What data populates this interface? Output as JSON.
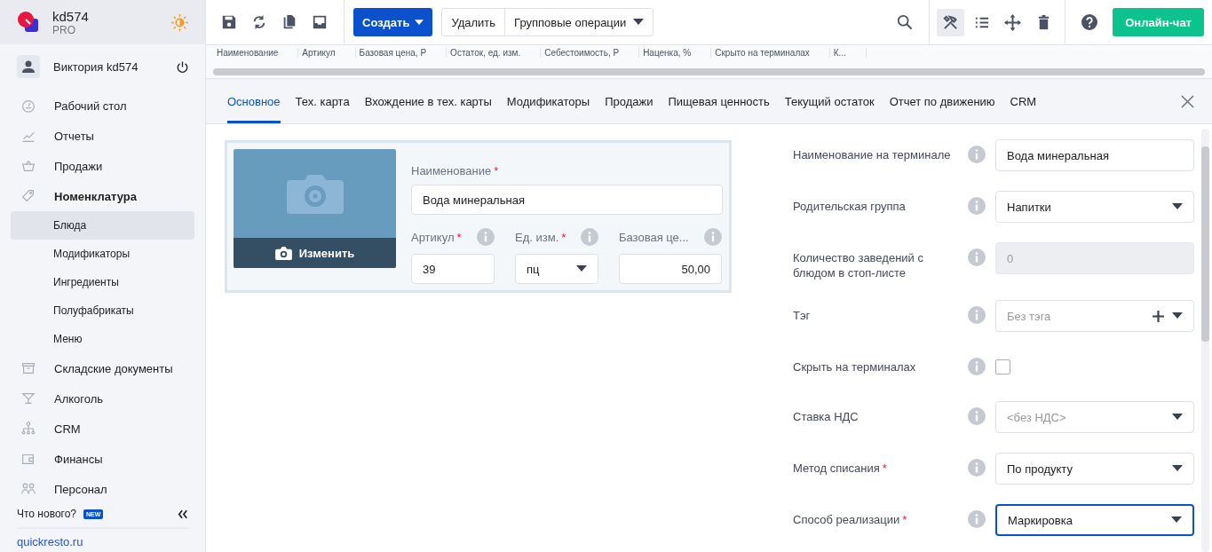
{
  "brand": {
    "name": "kd574",
    "plan": "PRO"
  },
  "user": {
    "name": "Виктория kd574"
  },
  "nav": [
    {
      "label": "Рабочий стол",
      "expanded": false
    },
    {
      "label": "Отчеты",
      "expanded": false
    },
    {
      "label": "Продажи",
      "expanded": false
    },
    {
      "label": "Номенклатура",
      "expanded": true,
      "children": [
        {
          "label": "Блюда",
          "selected": true
        },
        {
          "label": "Модификаторы",
          "selected": false
        },
        {
          "label": "Ингредиенты",
          "selected": false
        },
        {
          "label": "Полуфабрикаты",
          "selected": false
        },
        {
          "label": "Меню",
          "selected": false
        }
      ]
    },
    {
      "label": "Складские документы",
      "expanded": false
    },
    {
      "label": "Алкоголь",
      "expanded": false
    },
    {
      "label": "CRM",
      "expanded": false
    },
    {
      "label": "Финансы",
      "expanded": false
    },
    {
      "label": "Персонал",
      "expanded": false
    }
  ],
  "footer": {
    "whats_new": "Что нового?",
    "badge": "NEW",
    "link": "quickresto.ru"
  },
  "toolbar": {
    "create": "Создать",
    "delete": "Удалить",
    "group_ops": "Групповые операции",
    "chat": "Онлайн-чат",
    "view_tools": [
      {
        "selected": true
      },
      {
        "selected": false
      },
      {
        "selected": false
      },
      {
        "selected": false
      }
    ]
  },
  "table": {
    "columns": [
      "Наименование",
      "Артикул",
      "Базовая цена, Р",
      "Остаток, ед. изм.",
      "Себестоимость, Р",
      "Наценка, %",
      "Скрыто на терминалах",
      "К..."
    ]
  },
  "tabs": [
    {
      "label": "Основное",
      "selected": true
    },
    {
      "label": "Тех. карта",
      "selected": false
    },
    {
      "label": "Вхождение в тех. карты",
      "selected": false
    },
    {
      "label": "Модификаторы",
      "selected": false
    },
    {
      "label": "Продажи",
      "selected": false
    },
    {
      "label": "Пищевая ценность",
      "selected": false
    },
    {
      "label": "Текущий остаток",
      "selected": false
    },
    {
      "label": "Отчет по движению",
      "selected": false
    },
    {
      "label": "CRM",
      "selected": false
    }
  ],
  "card": {
    "change_photo": "Изменить",
    "name": {
      "label": "Наименование",
      "required_mark": "*",
      "value": "Вода минеральная"
    },
    "fields": [
      {
        "kind": "text",
        "label": "Артикул",
        "required_mark": "*",
        "value": "39"
      },
      {
        "kind": "select",
        "label": "Ед. изм.",
        "required_mark": "*",
        "value": "пц"
      },
      {
        "kind": "number",
        "label": "Базовая це...",
        "value": "50,00"
      }
    ]
  },
  "properties": [
    {
      "kind": "text",
      "label": "Наименование на терминале",
      "value": "Вода минеральная"
    },
    {
      "kind": "select",
      "label": "Родительская группа",
      "value": "Напитки"
    },
    {
      "kind": "text",
      "label": "Количество заведений с блюдом в стоп-листе",
      "placeholder": "0",
      "disabled": true
    },
    {
      "kind": "tag",
      "label": "Тэг",
      "placeholder": "Без тэга"
    },
    {
      "kind": "checkbox",
      "label": "Скрыть на терминалах",
      "checked": false
    },
    {
      "kind": "select",
      "label": "Ставка НДС",
      "placeholder": "<без НДС>"
    },
    {
      "kind": "select",
      "label": "Метод списания",
      "required_mark": "*",
      "value": "По продукту"
    },
    {
      "kind": "select",
      "label": "Способ реализации",
      "required_mark": "*",
      "value": "Маркировка",
      "focused": true
    }
  ]
}
